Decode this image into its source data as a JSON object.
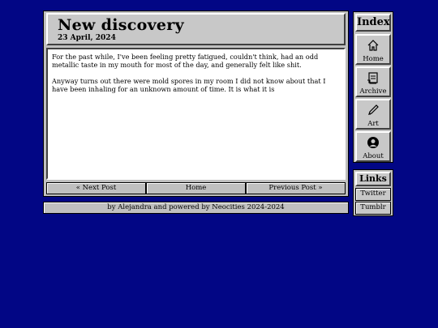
{
  "post": {
    "title": "New discovery",
    "date": "23 April, 2024",
    "paragraphs": [
      "For the past while, I've been feeling pretty fatigued, couldn't think, had an odd metallic taste in my mouth for most of the day, and generally felt like shit.",
      "Anyway turns out there were mold spores in my room I did not know about that I have been inhaling for an unknown amount of time. It is what it is"
    ]
  },
  "nav": {
    "next": "« Next Post",
    "home": "Home",
    "previous": "Previous Post »"
  },
  "footer": "by Alejandra and powered by Neocities 2024-2024",
  "sidebar": {
    "heading": "Index",
    "items": [
      {
        "label": "Home",
        "icon": "house-icon"
      },
      {
        "label": "Archive",
        "icon": "archive-icon"
      },
      {
        "label": "Art",
        "icon": "pencil-icon"
      },
      {
        "label": "About",
        "icon": "person-icon"
      }
    ]
  },
  "links": {
    "heading": "Links",
    "items": [
      "Twitter",
      "Tumblr"
    ]
  },
  "colors": {
    "background": "#020685",
    "panel": "#c0c0c0"
  }
}
